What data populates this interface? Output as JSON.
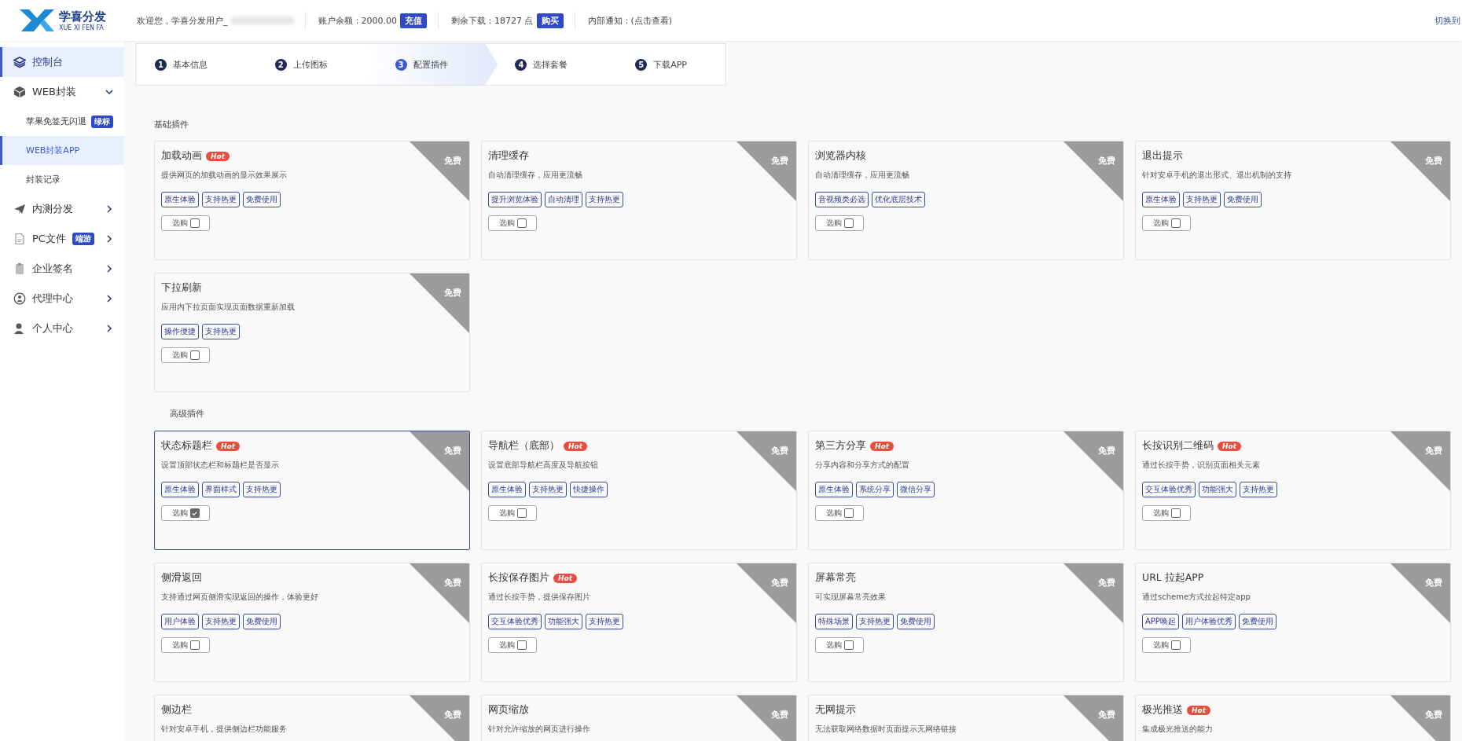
{
  "header": {
    "logo_text": "学喜分发",
    "logo_sub": "XUE XI FEN FA",
    "welcome": "欢迎您，学喜分发用户_",
    "balance": "账户余额：2000.00",
    "recharge_button": "充值",
    "downloads": "剩余下载：18727 点",
    "buy_button": "购买",
    "notice": "内部通知：(点击查看)",
    "switch_link": "切换到"
  },
  "sidebar": {
    "items": [
      {
        "label": "控制台",
        "selected": true
      },
      {
        "label": "WEB封装",
        "selected": false,
        "expanded": true,
        "children": [
          {
            "label": "苹果免签无闪退",
            "badge": "绿标",
            "selected": false
          },
          {
            "label": "WEB封装APP",
            "selected": true
          },
          {
            "label": "封装记录",
            "selected": false
          }
        ]
      },
      {
        "label": "内测分发",
        "selected": false,
        "expanded": false
      },
      {
        "label": "PC文件",
        "badge": "端游",
        "selected": false,
        "expanded": false
      },
      {
        "label": "企业签名",
        "selected": false,
        "expanded": false
      },
      {
        "label": "代理中心",
        "selected": false,
        "expanded": false
      },
      {
        "label": "个人中心",
        "selected": false,
        "expanded": false
      }
    ]
  },
  "steps": [
    {
      "number": "1",
      "label": "基本信息",
      "selected": false
    },
    {
      "number": "2",
      "label": "上传图标",
      "selected": false
    },
    {
      "number": "3",
      "label": "配置插件",
      "selected": true
    },
    {
      "number": "4",
      "label": "选择套餐",
      "selected": false
    },
    {
      "number": "5",
      "label": "下载APP",
      "selected": false
    }
  ],
  "sections": [
    {
      "title": "基础插件",
      "cards": [
        {
          "title": "加载动画",
          "hot": "Hot",
          "desc": "提供网页的加载动画的显示效果展示",
          "tags": [
            "原生体验",
            "支持热更",
            "免费使用"
          ],
          "price": "免费",
          "button": "选购",
          "checked": false
        },
        {
          "title": "清理缓存",
          "desc": "自动清理缓存，应用更流畅",
          "tags": [
            "提升浏览体验",
            "自动清理",
            "支持热更"
          ],
          "price": "免费",
          "button": "选购",
          "checked": false
        },
        {
          "title": "浏览器内核",
          "desc": "自动清理缓存，应用更流畅",
          "tags": [
            "音视频类必选",
            "优化底层技术"
          ],
          "price": "免费",
          "button": "选购",
          "checked": false
        },
        {
          "title": "退出提示",
          "desc": "针对安卓手机的退出形式、退出机制的支持",
          "tags": [
            "原生体验",
            "支持热更",
            "免费使用"
          ],
          "price": "免费",
          "button": "选购",
          "checked": false
        },
        {
          "title": "下拉刷新",
          "desc": "应用内下拉页面实现页面数据重新加载",
          "tags": [
            "操作便捷",
            "支持热更"
          ],
          "price": "免费",
          "button": "选购",
          "checked": false
        }
      ]
    },
    {
      "title": "高级插件",
      "cards": [
        {
          "title": "状态标题栏",
          "hot": "Hot",
          "desc": "设置顶部状态栏和标题栏是否显示",
          "tags": [
            "原生体验",
            "界面样式",
            "支持热更"
          ],
          "price": "免费",
          "button": "选购",
          "checked": true
        },
        {
          "title": "导航栏（底部）",
          "hot": "Hot",
          "desc": "设置底部导航栏高度及导航按钮",
          "tags": [
            "原生体验",
            "支持热更",
            "快捷操作"
          ],
          "price": "免费",
          "button": "选购",
          "checked": false
        },
        {
          "title": "第三方分享",
          "hot": "Hot",
          "desc": "分享内容和分享方式的配置",
          "tags": [
            "原生体验",
            "系统分享",
            "微信分享"
          ],
          "price": "免费",
          "button": "选购",
          "checked": false
        },
        {
          "title": "长按识别二维码",
          "hot": "Hot",
          "desc": "通过长按手势，识别页面相关元素",
          "tags": [
            "交互体验优秀",
            "功能强大",
            "支持热更"
          ],
          "price": "免费",
          "button": "选购",
          "checked": false
        },
        {
          "title": "侧滑返回",
          "desc": "支持通过网页侧滑实现返回的操作，体验更好",
          "tags": [
            "用户体验",
            "支持热更",
            "免费使用"
          ],
          "price": "免费",
          "button": "选购",
          "checked": false
        },
        {
          "title": "长按保存图片",
          "hot": "Hot",
          "desc": "通过长按手势，提供保存图片",
          "tags": [
            "交互体验优秀",
            "功能强大",
            "支持热更"
          ],
          "price": "免费",
          "button": "选购",
          "checked": false
        },
        {
          "title": "屏幕常亮",
          "desc": "可实现屏幕常亮效果",
          "tags": [
            "特殊场景",
            "支持热更",
            "免费使用"
          ],
          "price": "免费",
          "button": "选购",
          "checked": false
        },
        {
          "title": "URL 拉起APP",
          "desc": "通过scheme方式拉起特定app",
          "tags": [
            "APP唤起",
            "用户体验优秀",
            "免费使用"
          ],
          "price": "免费",
          "button": "选购",
          "checked": false
        },
        {
          "title": "侧边栏",
          "desc": "针对安卓手机，提供侧边栏功能服务",
          "price": "免费"
        },
        {
          "title": "网页缩放",
          "desc": "针对允许缩放的网页进行操作",
          "price": "免费"
        },
        {
          "title": "无网提示",
          "desc": "无法获取网络数据时页面提示无网络链接",
          "price": "免费"
        },
        {
          "title": "极光推送",
          "hot": "Hot",
          "desc": "集成极光推送的能力",
          "price": "免费"
        }
      ]
    }
  ]
}
